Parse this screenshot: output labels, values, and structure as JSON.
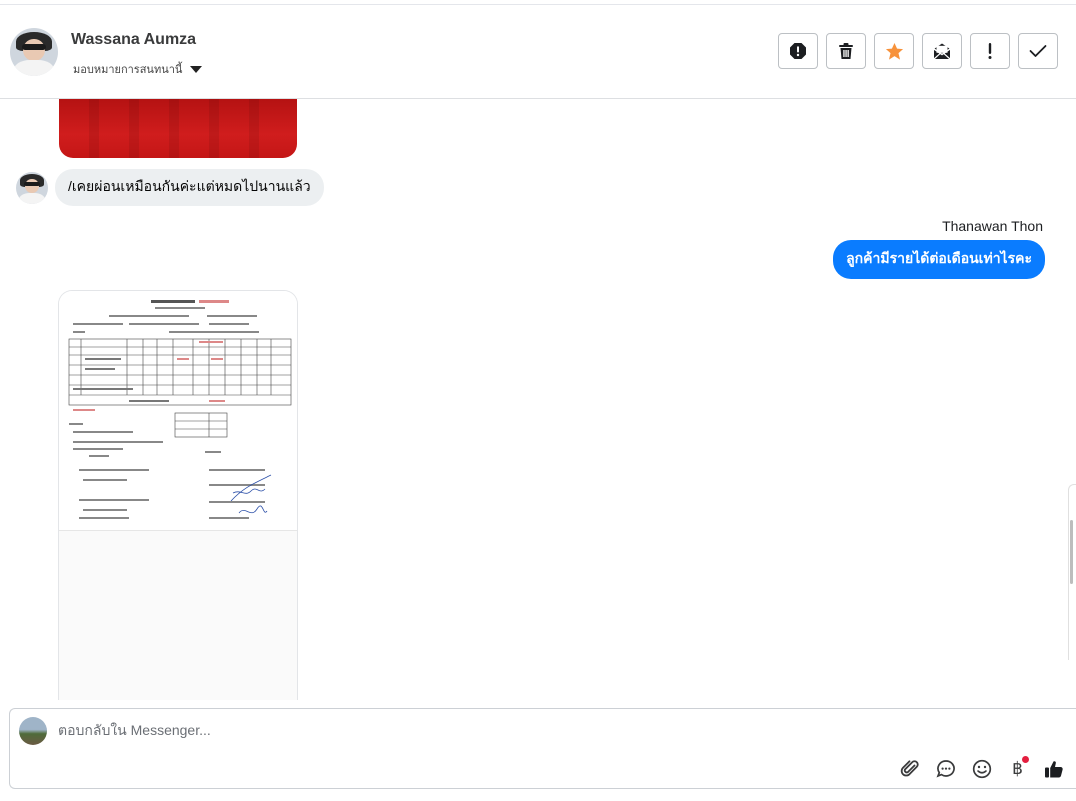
{
  "header": {
    "contact_name": "Wassana Aumza",
    "assign_label": "มอบหมายการสนทนานี้",
    "actions": [
      {
        "name": "report-icon"
      },
      {
        "name": "trash-icon"
      },
      {
        "name": "star-icon",
        "color": "#f7923b"
      },
      {
        "name": "mail-icon"
      },
      {
        "name": "important-icon"
      },
      {
        "name": "check-icon"
      }
    ]
  },
  "messages": {
    "incoming_text": "/เคยผ่อนเหมือนกันค่ะแต่หมดไปนานแล้ว",
    "outgoing_sender": "Thanawan Thon",
    "outgoing_text": "ลูกค้ามีรายได้ต่อเดือนเท่าไรคะ"
  },
  "composer": {
    "placeholder": "ตอบกลับใน Messenger...",
    "value": "",
    "tools": [
      "attachment-icon",
      "saved-replies-icon",
      "emoji-icon",
      "baht-icon",
      "like-icon"
    ],
    "baht_glyph": "฿"
  },
  "colors": {
    "outgoing_bubble": "#0a7cff",
    "incoming_bubble": "#eceff1",
    "accent_star": "#f7923b",
    "notification_dot": "#e41e3f"
  }
}
